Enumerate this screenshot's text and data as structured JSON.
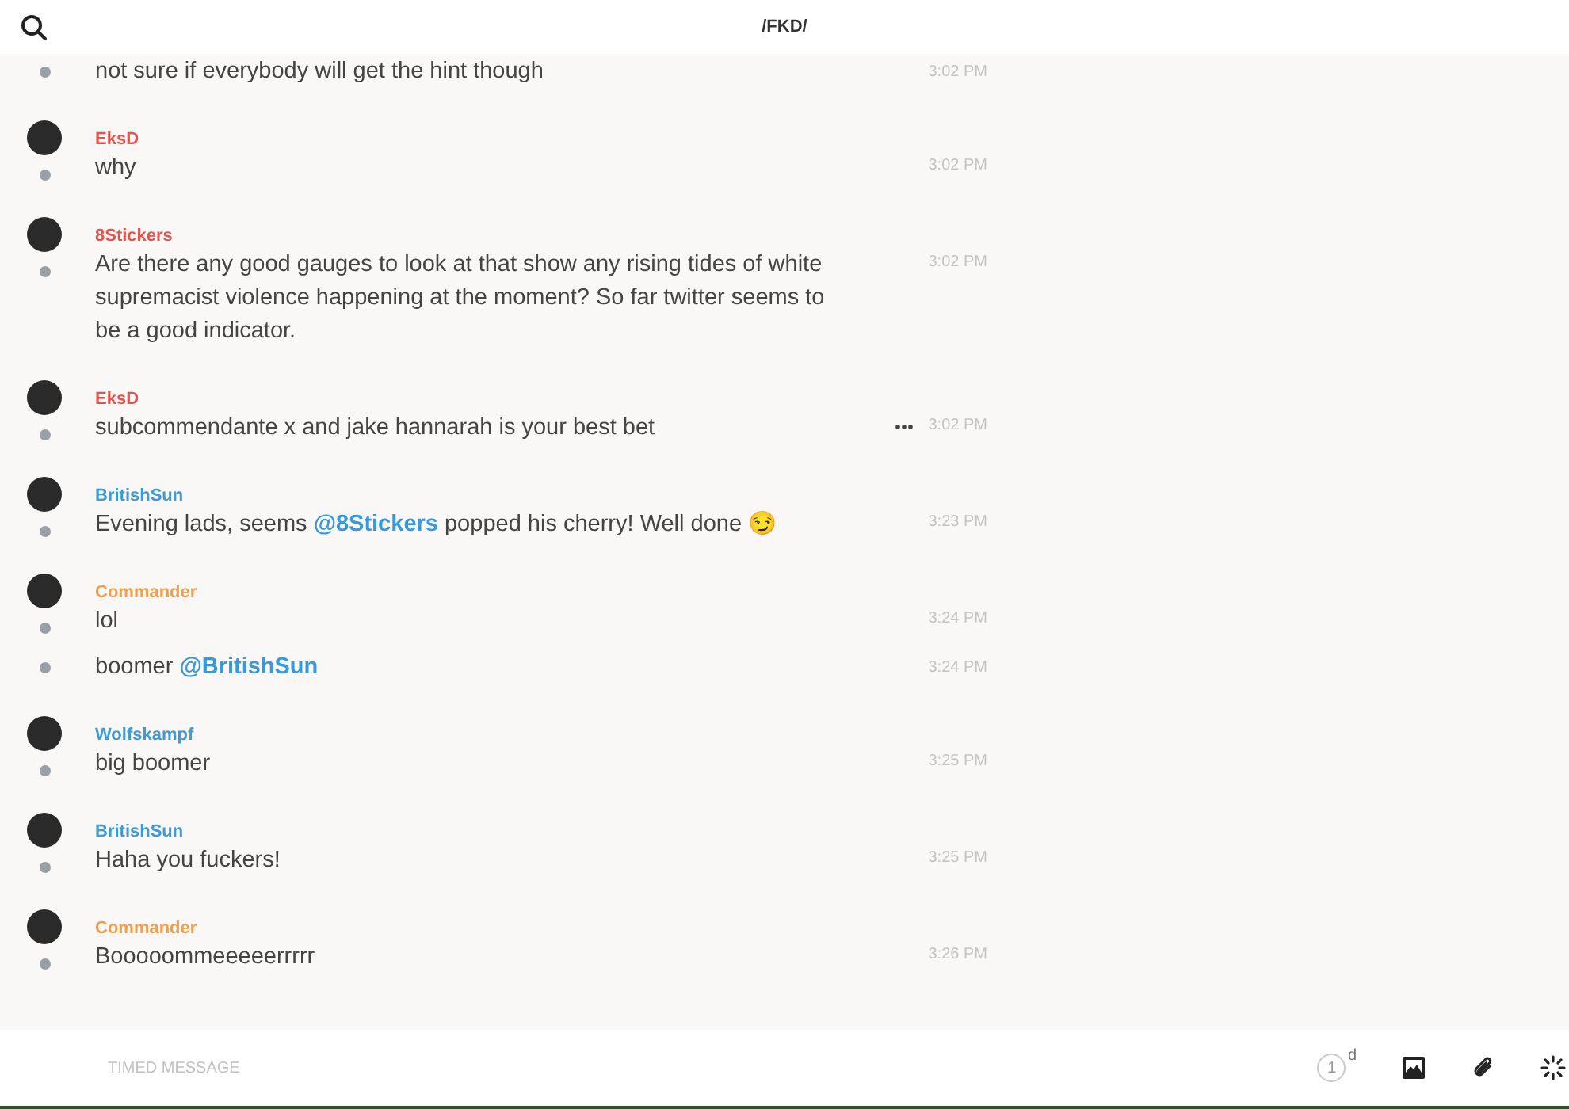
{
  "header": {
    "title": "/FKD/"
  },
  "messages": [
    {
      "text": "not sure if everybody will get the hint though",
      "time": "3:02 PM",
      "menu_shown": false
    },
    {
      "author": {
        "name": "EksD",
        "color": "#e5534b"
      },
      "text": "why",
      "time": "3:02 PM",
      "menu_shown": false
    },
    {
      "author": {
        "name": "8Stickers",
        "color": "#e5534b"
      },
      "text": "Are there any good gauges to look at that show any rising tides of white supremacist violence happening at the moment? So far twitter seems to be a good indicator.",
      "time": "3:02 PM",
      "menu_shown": false
    },
    {
      "author": {
        "name": "EksD",
        "color": "#e5534b"
      },
      "text": "subcommendante x and jake hannarah is your best bet",
      "time": "3:02 PM",
      "menu_shown": true
    },
    {
      "author": {
        "name": "BritishSun",
        "color": "#3d9bd6"
      },
      "text": "Evening lads, seems **@8Stickers** popped his cherry! Well done 😏",
      "time": "3:23 PM",
      "menu_shown": false
    },
    {
      "author": {
        "name": "Commander",
        "color": "#f0a04b"
      },
      "text": "lol",
      "time": "3:24 PM",
      "menu_shown": false
    },
    {
      "text": "boomer **@BritishSun**",
      "time": "3:24 PM",
      "menu_shown": false
    },
    {
      "author": {
        "name": "Wolfskampf",
        "color": "#3d9bd6"
      },
      "text": "big boomer",
      "time": "3:25 PM",
      "menu_shown": false
    },
    {
      "author": {
        "name": "BritishSun",
        "color": "#3d9bd6"
      },
      "text": "Haha you fuckers!",
      "time": "3:25 PM",
      "menu_shown": false
    },
    {
      "author": {
        "name": "Commander",
        "color": "#f0a04b"
      },
      "text": "Booooommeeeeerrrrr",
      "time": "3:26 PM",
      "menu_shown": false
    }
  ],
  "composer": {
    "placeholder": "TIMED MESSAGE",
    "timer_value": "1",
    "timer_unit": "d"
  }
}
